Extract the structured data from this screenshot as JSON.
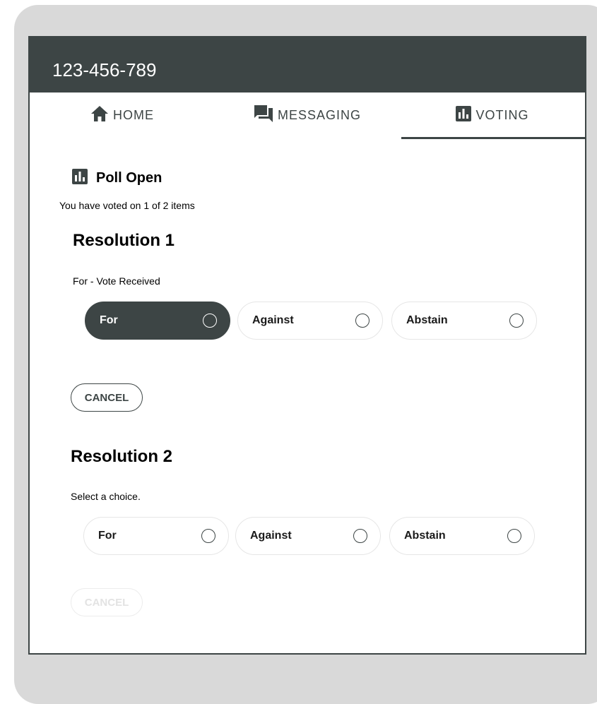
{
  "header": {
    "title": "123-456-789"
  },
  "tabs": [
    {
      "label": "HOME",
      "icon": "home-icon"
    },
    {
      "label": "MESSAGING",
      "icon": "chat-icon"
    },
    {
      "label": "VOTING",
      "icon": "poll-icon",
      "active": true
    }
  ],
  "poll": {
    "title": "Poll Open",
    "progress_text": "You have voted on 1 of 2 items"
  },
  "resolutions": [
    {
      "title": "Resolution 1",
      "status": "For - Vote Received",
      "choices": [
        {
          "label": "For",
          "selected": true
        },
        {
          "label": "Against",
          "selected": false
        },
        {
          "label": "Abstain",
          "selected": false
        }
      ],
      "cancel_label": "CANCEL",
      "cancel_enabled": true
    },
    {
      "title": "Resolution 2",
      "status": "Select a choice.",
      "choices": [
        {
          "label": "For",
          "selected": false
        },
        {
          "label": "Against",
          "selected": false
        },
        {
          "label": "Abstain",
          "selected": false
        }
      ],
      "cancel_label": "CANCEL",
      "cancel_enabled": false
    }
  ],
  "colors": {
    "primary": "#3d4545",
    "frame": "#d9d9d9",
    "disabled": "#e3e3e3"
  }
}
